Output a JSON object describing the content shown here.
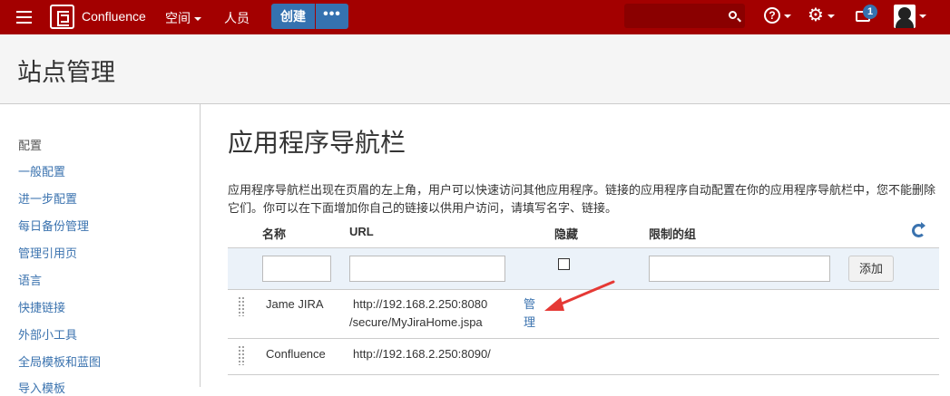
{
  "topbar": {
    "brand": "Confluence",
    "spaces": "空间",
    "people": "人员",
    "create": "创建",
    "more": "•••",
    "help": "?",
    "notification_count": "1"
  },
  "header": {
    "title": "站点管理"
  },
  "sidebar": {
    "section": "配置",
    "items": [
      {
        "label": "一般配置"
      },
      {
        "label": "进一步配置"
      },
      {
        "label": "每日备份管理"
      },
      {
        "label": "管理引用页"
      },
      {
        "label": "语言"
      },
      {
        "label": "快捷链接"
      },
      {
        "label": "外部小工具"
      },
      {
        "label": "全局模板和蓝图"
      },
      {
        "label": "导入模板"
      }
    ]
  },
  "main": {
    "title": "应用程序导航栏",
    "description": "应用程序导航栏出现在页眉的左上角，用户可以快速访问其他应用程序。链接的应用程序自动配置在你的应用程序导航栏中，您不能删除它们。你可以在下面增加你自己的链接以供用户访问，请填写名字、链接。",
    "table": {
      "headers": {
        "name": "名称",
        "url": "URL",
        "hidden": "隐藏",
        "groups": "限制的组"
      },
      "add_label": "添加",
      "rows": [
        {
          "name": "Jame JIRA",
          "url_line1": "http://192.168.2.250:8080",
          "url_line2": "/secure/MyJiraHome.jspa",
          "action_line1": "管",
          "action_line2": "理"
        },
        {
          "name": "Confluence",
          "url_line1": "http://192.168.2.250:8090/"
        }
      ]
    }
  },
  "colors": {
    "topbar": "#a30000",
    "primary": "#3572b0",
    "link": "#3b73af",
    "annotation": "#e53935"
  }
}
